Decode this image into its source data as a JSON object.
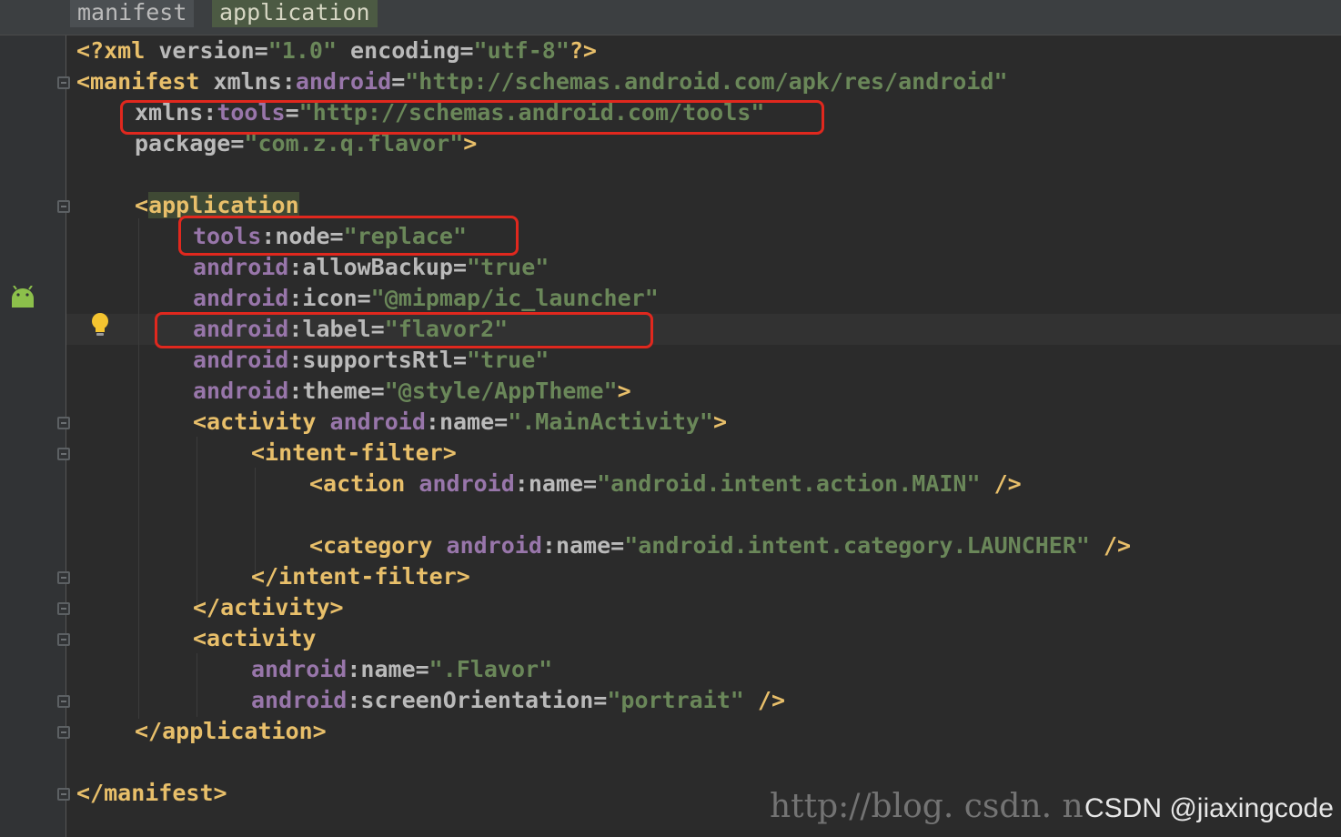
{
  "breadcrumb": {
    "items": [
      "manifest",
      "application"
    ]
  },
  "lines": {
    "l1": {
      "a": "<?xml",
      "b": " version=",
      "c": "\"1.0\"",
      "d": " encoding=",
      "e": "\"utf-8\"",
      "f": "?>"
    },
    "l2": {
      "a": "<manifest",
      "b": " xmlns:",
      "c": "android",
      "d": "=",
      "e": "\"http://schemas.android.com/apk/res/android\""
    },
    "l3": {
      "a": "xmlns:",
      "b": "tools",
      "c": "=",
      "d": "\"http://schemas.android.com/tools\""
    },
    "l4": {
      "a": "package=",
      "b": "\"com.z.q.flavor\"",
      "c": ">"
    },
    "l5": {
      "a": "<",
      "b": "application"
    },
    "l6": {
      "a": "tools",
      "b": ":node=",
      "c": "\"replace\""
    },
    "l7": {
      "a": "android",
      "b": ":allowBackup=",
      "c": "\"true\""
    },
    "l8": {
      "a": "android",
      "b": ":icon=",
      "c": "\"@mipmap/ic_launcher\""
    },
    "l9": {
      "a": "android",
      "b": ":label=",
      "c": "\"flavor2\""
    },
    "l10": {
      "a": "android",
      "b": ":supportsRtl=",
      "c": "\"true\""
    },
    "l11": {
      "a": "android",
      "b": ":theme=",
      "c": "\"@style/AppTheme\"",
      "d": ">"
    },
    "l12": {
      "a": "<activity",
      "b": " android",
      "c": ":name=",
      "d": "\".MainActivity\"",
      "e": ">"
    },
    "l13": {
      "a": "<intent-filter>"
    },
    "l14": {
      "a": "<action",
      "b": " android",
      "c": ":name=",
      "d": "\"android.intent.action.MAIN\"",
      "e": " />"
    },
    "l15": {
      "a": "<category",
      "b": " android",
      "c": ":name=",
      "d": "\"android.intent.category.LAUNCHER\"",
      "e": " />"
    },
    "l16": {
      "a": "</intent-filter>"
    },
    "l17": {
      "a": "</activity>"
    },
    "l18": {
      "a": "<activity"
    },
    "l19": {
      "a": "android",
      "b": ":name=",
      "c": "\".Flavor\""
    },
    "l20": {
      "a": "android",
      "b": ":screenOrientation=",
      "c": "\"portrait\"",
      "d": " />"
    },
    "l21": {
      "a": "</application>"
    },
    "l22": {
      "a": "</manifest>"
    }
  },
  "watermark": {
    "blog": "http://blog. csdn. n",
    "csdn": "CSDN @jiaxingcode"
  },
  "icons": {
    "gutter": "android-icon",
    "intention": "bulb-icon",
    "fold": "fold-icon"
  },
  "colors": {
    "background": "#2b2b2b",
    "tag": "#e8bf6a",
    "attribute": "#bababa",
    "namespace": "#9876aa",
    "string": "#6a8759",
    "highlight_box": "#e0281e"
  }
}
